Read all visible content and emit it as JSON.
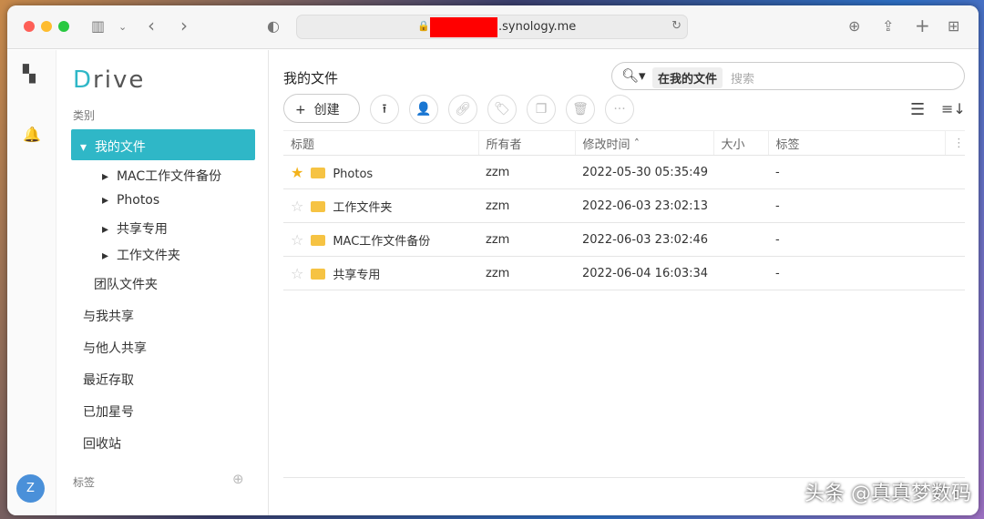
{
  "browser": {
    "url_suffix": ".synology.me"
  },
  "sidebar": {
    "logo": "Drive",
    "category_label": "类别",
    "my_files": "我的文件",
    "subfolders": [
      "MAC工作文件备份",
      "Photos",
      "共享专用",
      "工作文件夹"
    ],
    "team_folder": "团队文件夹",
    "items": [
      "与我共享",
      "与他人共享",
      "最近存取",
      "已加星号",
      "回收站"
    ],
    "tags_label": "标签",
    "avatar": "Z"
  },
  "main": {
    "title": "我的文件",
    "search_scope": "在我的文件",
    "search_placeholder": "搜索",
    "create_label": "创建",
    "columns": [
      "标题",
      "所有者",
      "修改时间 ˆ",
      "大小",
      "标签"
    ],
    "rows": [
      {
        "name": "Photos",
        "owner": "zzm",
        "modified": "2022-05-30 05:35:49",
        "size": "",
        "tag": "-",
        "starred": true
      },
      {
        "name": "工作文件夹",
        "owner": "zzm",
        "modified": "2022-06-03 23:02:13",
        "size": "",
        "tag": "-",
        "starred": false
      },
      {
        "name": "MAC工作文件备份",
        "owner": "zzm",
        "modified": "2022-06-03 23:02:46",
        "size": "",
        "tag": "-",
        "starred": false
      },
      {
        "name": "共享专用",
        "owner": "zzm",
        "modified": "2022-06-04 16:03:34",
        "size": "",
        "tag": "-",
        "starred": false
      }
    ]
  },
  "watermark": "头条 @真真梦数码"
}
